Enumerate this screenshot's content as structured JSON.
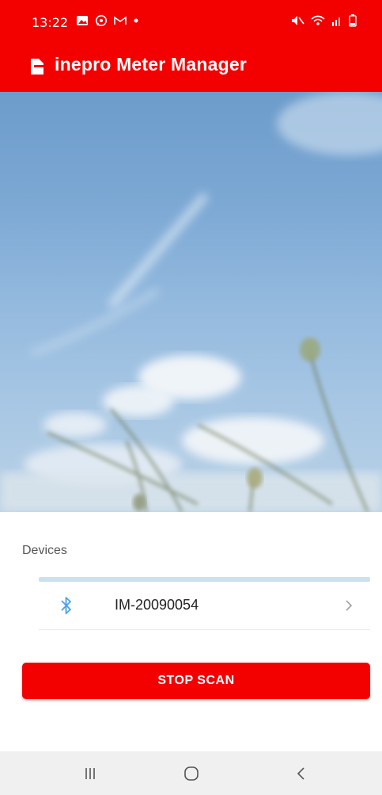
{
  "status_bar": {
    "time": "13:22",
    "left_icons": [
      "gallery-icon",
      "whatsapp-icon",
      "gmail-icon",
      "dot-icon"
    ],
    "right_icons": [
      "mute-icon",
      "wifi-icon",
      "signal-icon",
      "battery-low-icon"
    ],
    "background": "#f30000"
  },
  "app_bar": {
    "title": "inepro Meter Manager",
    "logo_icon": "inepro-logo-icon",
    "background": "#f30000"
  },
  "devices": {
    "heading": "Devices",
    "items": [
      {
        "name": "IM-20090054",
        "icon": "bluetooth-icon",
        "chevron": "chevron-right-icon"
      }
    ]
  },
  "stop_scan": {
    "label": "STOP SCAN"
  },
  "nav_bar": {
    "recents_icon": "recents-icon",
    "home_icon": "home-icon",
    "back_icon": "back-icon"
  },
  "colors": {
    "accent": "#f30000",
    "bluetooth": "#4aa3df",
    "progress": "#c9e3ee"
  }
}
